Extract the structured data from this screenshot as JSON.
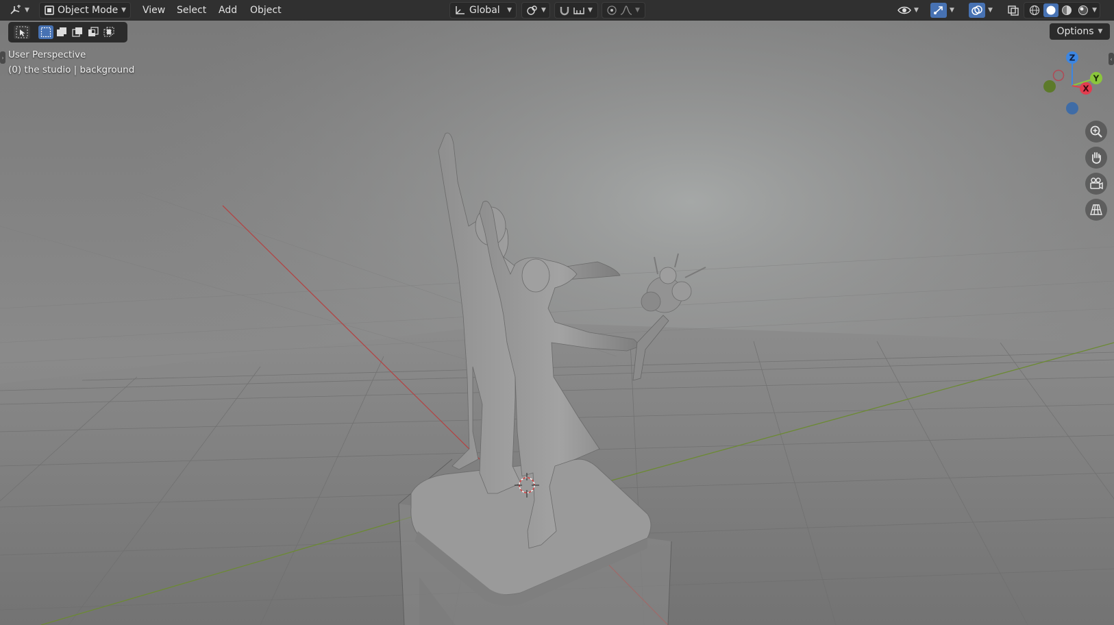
{
  "header": {
    "editor_type_icon": "3d-viewport-icon",
    "mode": {
      "label": "Object Mode",
      "icon": "object-mode-icon"
    },
    "menus": [
      "View",
      "Select",
      "Add",
      "Object"
    ],
    "transform_orientation": {
      "label": "Global",
      "icon": "orientation-axes-icon"
    },
    "pivot_icon": "pivot-point-icon",
    "snap_icon": "magnet-snap-icon",
    "snap_target_icon": "snap-increment-icon",
    "proportional_icon": "proportional-editing-icon",
    "falloff_icon": "falloff-curve-icon",
    "visibility_icon": "object-visibility-icon",
    "gizmo_icon": "gizmo-toggle-icon",
    "overlays_icon": "overlays-icon",
    "xray_icon": "xray-toggle-icon",
    "shading_modes": [
      "wireframe",
      "solid",
      "material-preview",
      "rendered"
    ],
    "active_shading": "solid"
  },
  "toolbar": {
    "select_tool_icon": "select-cursor-icon",
    "selection_modes": [
      "select-new",
      "select-extend",
      "select-subtract",
      "select-invert",
      "select-intersect"
    ],
    "options_label": "Options"
  },
  "viewport": {
    "perspective_label": "User Perspective",
    "collection_label": "(0) the studio | background"
  },
  "navigation_gizmo": {
    "axes": {
      "x": "X",
      "y": "Y",
      "z": "Z"
    },
    "buttons": [
      "zoom-icon",
      "pan-hand-icon",
      "camera-view-icon",
      "orthographic-grid-icon"
    ]
  },
  "colors": {
    "header_bg": "#303030",
    "accent": "#4772b3",
    "axis_x": "#e13d4f",
    "axis_y": "#8bc63c",
    "axis_z": "#3d86e1",
    "grid_x_line": "#b24545",
    "grid_y_line": "#6c8a33"
  }
}
